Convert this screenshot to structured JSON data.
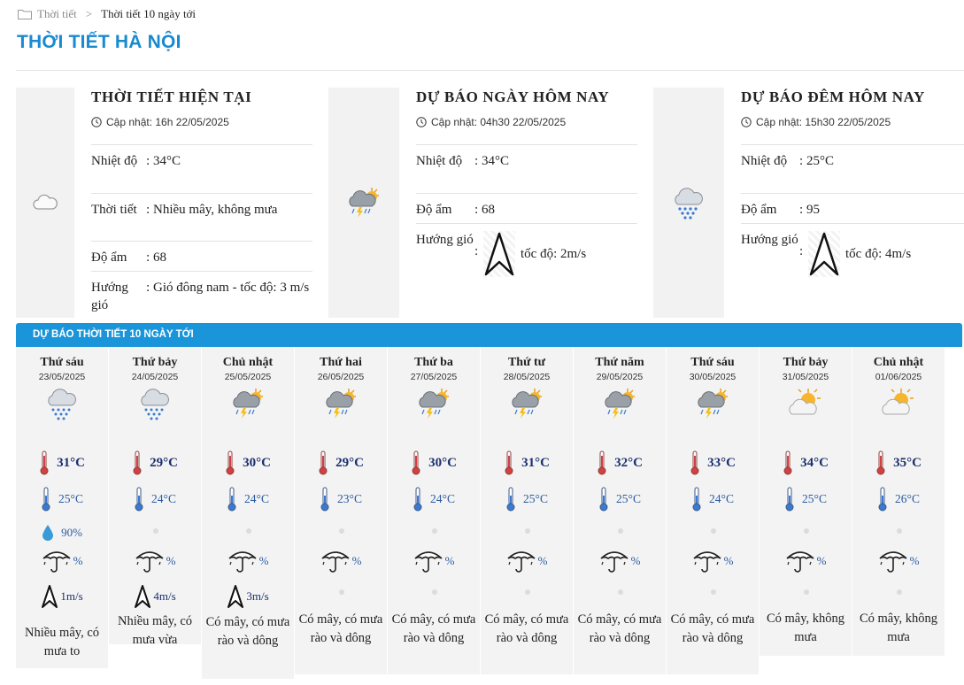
{
  "breadcrumb": {
    "home": "Thời tiết",
    "separator": ">",
    "current": "Thời tiết 10 ngày tới"
  },
  "page_title": "THỜI TIẾT HÀ NỘI",
  "current": {
    "heading": "THỜI TIẾT HIỆN TẠI",
    "update": "Cập nhật: 16h 22/05/2025",
    "icon": "cloud-icon",
    "rows": [
      {
        "label": "Nhiệt độ",
        "value": "34°C"
      },
      {
        "label": "Thời tiết",
        "value": "Nhiều mây, không mưa"
      },
      {
        "label": "Độ ẩm",
        "value": "68"
      },
      {
        "label": "Hướng gió",
        "value": "Gió đông nam - tốc độ: 3 m/s"
      }
    ]
  },
  "today": {
    "heading": "DỰ BÁO NGÀY HÔM NAY",
    "update": "Cập nhật: 04h30 22/05/2025",
    "icon": "thunderstorm-sun-icon",
    "temp_label": "Nhiệt độ",
    "temp": "34°C",
    "humidity_label": "Độ ẩm",
    "humidity": "68",
    "wind_label": "Hướng gió",
    "wind_speed": "tốc độ: 2m/s"
  },
  "tonight": {
    "heading": "DỰ BÁO ĐÊM HÔM NAY",
    "update": "Cập nhật: 15h30 22/05/2025",
    "icon": "rain-cloud-icon",
    "temp_label": "Nhiệt độ",
    "temp": "25°C",
    "humidity_label": "Độ ẩm",
    "humidity": "95",
    "wind_label": "Hướng gió",
    "wind_speed": "tốc độ: 4m/s"
  },
  "forecast_title": "DỰ BÁO THỜI TIẾT 10 NGÀY TỚI",
  "days": [
    {
      "name": "Thứ sáu",
      "date": "23/05/2025",
      "icon": "rain",
      "max": "31°C",
      "min": "25°C",
      "humidity": "90%",
      "rain": "%",
      "wind": "1m/s",
      "desc": "Nhiều mây, có mưa to"
    },
    {
      "name": "Thứ bảy",
      "date": "24/05/2025",
      "icon": "rain",
      "max": "29°C",
      "min": "24°C",
      "humidity": "",
      "rain": "%",
      "wind": "4m/s",
      "desc": "Nhiều mây, có mưa vừa"
    },
    {
      "name": "Chủ nhật",
      "date": "25/05/2025",
      "icon": "storm",
      "max": "30°C",
      "min": "24°C",
      "humidity": "",
      "rain": "%",
      "wind": "3m/s",
      "desc": "Có mây, có mưa rào và dông"
    },
    {
      "name": "Thứ hai",
      "date": "26/05/2025",
      "icon": "storm",
      "max": "29°C",
      "min": "23°C",
      "humidity": "",
      "rain": "%",
      "wind": "",
      "desc": "Có mây, có mưa rào và dông"
    },
    {
      "name": "Thứ ba",
      "date": "27/05/2025",
      "icon": "storm",
      "max": "30°C",
      "min": "24°C",
      "humidity": "",
      "rain": "%",
      "wind": "",
      "desc": "Có mây, có mưa rào và dông"
    },
    {
      "name": "Thứ tư",
      "date": "28/05/2025",
      "icon": "storm",
      "max": "31°C",
      "min": "25°C",
      "humidity": "",
      "rain": "%",
      "wind": "",
      "desc": "Có mây, có mưa rào và dông"
    },
    {
      "name": "Thứ năm",
      "date": "29/05/2025",
      "icon": "storm",
      "max": "32°C",
      "min": "25°C",
      "humidity": "",
      "rain": "%",
      "wind": "",
      "desc": "Có mây, có mưa rào và dông"
    },
    {
      "name": "Thứ sáu",
      "date": "30/05/2025",
      "icon": "storm",
      "max": "33°C",
      "min": "24°C",
      "humidity": "",
      "rain": "%",
      "wind": "",
      "desc": "Có mây, có mưa rào và dông"
    },
    {
      "name": "Thứ bảy",
      "date": "31/05/2025",
      "icon": "sun-cloud",
      "max": "34°C",
      "min": "25°C",
      "humidity": "",
      "rain": "%",
      "wind": "",
      "desc": "Có mây, không mưa"
    },
    {
      "name": "Chủ nhật",
      "date": "01/06/2025",
      "icon": "sun-cloud",
      "max": "35°C",
      "min": "26°C",
      "humidity": "",
      "rain": "%",
      "wind": "",
      "desc": "Có mây, không mưa"
    }
  ],
  "colors": {
    "accent": "#1b95d9",
    "title": "#1a8ad0",
    "temp_max": "#1b2f6e",
    "temp_min": "#2a5aa0"
  }
}
